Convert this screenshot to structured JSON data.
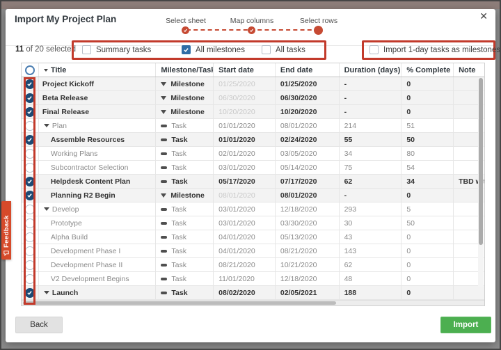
{
  "dialog": {
    "title": "Import My Project Plan",
    "close_glyph": "✕",
    "stepper": {
      "steps": [
        {
          "label": "Select sheet",
          "state": "done"
        },
        {
          "label": "Map columns",
          "state": "done"
        },
        {
          "label": "Select rows",
          "state": "current"
        }
      ]
    },
    "selection_summary": {
      "count": "11",
      "text": " of 20 selected"
    },
    "filter_checkboxes": [
      {
        "label": "Summary tasks",
        "checked": false
      },
      {
        "label": "All milestones",
        "checked": true
      },
      {
        "label": "All tasks",
        "checked": false
      }
    ],
    "import_option": {
      "label": "Import 1-day tasks as milestones",
      "checked": false
    },
    "table": {
      "columns": [
        "Title",
        "Milestone/Task",
        "Start date",
        "End date",
        "Duration (days)",
        "% Complete",
        "Note"
      ],
      "rows": [
        {
          "title": "Project Kickoff",
          "type": "Milestone",
          "start": "01/25/2020",
          "end": "01/25/2020",
          "duration": "-",
          "pct": "0",
          "note": "",
          "selected": true,
          "indent": 0,
          "expandable": false
        },
        {
          "title": "Beta Release",
          "type": "Milestone",
          "start": "06/30/2020",
          "end": "06/30/2020",
          "duration": "-",
          "pct": "0",
          "note": "",
          "selected": true,
          "indent": 0,
          "expandable": false
        },
        {
          "title": "Final Release",
          "type": "Milestone",
          "start": "10/20/2020",
          "end": "10/20/2020",
          "duration": "-",
          "pct": "0",
          "note": "",
          "selected": true,
          "indent": 0,
          "expandable": false
        },
        {
          "title": "Plan",
          "type": "Task",
          "start": "01/01/2020",
          "end": "08/01/2020",
          "duration": "214",
          "pct": "51",
          "note": "",
          "selected": false,
          "indent": 1,
          "expandable": true
        },
        {
          "title": "Assemble Resources",
          "type": "Task",
          "start": "01/01/2020",
          "end": "02/24/2020",
          "duration": "55",
          "pct": "50",
          "note": "",
          "selected": true,
          "indent": 2,
          "expandable": false
        },
        {
          "title": "Working Plans",
          "type": "Task",
          "start": "02/01/2020",
          "end": "03/05/2020",
          "duration": "34",
          "pct": "80",
          "note": "",
          "selected": false,
          "indent": 2,
          "expandable": false
        },
        {
          "title": "Subcontractor Selection",
          "type": "Task",
          "start": "03/01/2020",
          "end": "05/14/2020",
          "duration": "75",
          "pct": "54",
          "note": "",
          "selected": false,
          "indent": 2,
          "expandable": false
        },
        {
          "title": "Helpdesk Content Plan",
          "type": "Task",
          "start": "05/17/2020",
          "end": "07/17/2020",
          "duration": "62",
          "pct": "34",
          "note": "TBD with M",
          "selected": true,
          "indent": 2,
          "expandable": false
        },
        {
          "title": "Planning R2 Begin",
          "type": "Milestone",
          "start": "08/01/2020",
          "end": "08/01/2020",
          "duration": "-",
          "pct": "0",
          "note": "",
          "selected": true,
          "indent": 2,
          "expandable": false
        },
        {
          "title": "Develop",
          "type": "Task",
          "start": "03/01/2020",
          "end": "12/18/2020",
          "duration": "293",
          "pct": "5",
          "note": "",
          "selected": false,
          "indent": 1,
          "expandable": true
        },
        {
          "title": "Prototype",
          "type": "Task",
          "start": "03/01/2020",
          "end": "03/30/2020",
          "duration": "30",
          "pct": "50",
          "note": "",
          "selected": false,
          "indent": 2,
          "expandable": false
        },
        {
          "title": "Alpha Build",
          "type": "Task",
          "start": "04/01/2020",
          "end": "05/13/2020",
          "duration": "43",
          "pct": "0",
          "note": "",
          "selected": false,
          "indent": 2,
          "expandable": false
        },
        {
          "title": "Development Phase I",
          "type": "Task",
          "start": "04/01/2020",
          "end": "08/21/2020",
          "duration": "143",
          "pct": "0",
          "note": "",
          "selected": false,
          "indent": 2,
          "expandable": false
        },
        {
          "title": "Development Phase II",
          "type": "Task",
          "start": "08/21/2020",
          "end": "10/21/2020",
          "duration": "62",
          "pct": "0",
          "note": "",
          "selected": false,
          "indent": 2,
          "expandable": false
        },
        {
          "title": "V2 Development Begins",
          "type": "Task",
          "start": "11/01/2020",
          "end": "12/18/2020",
          "duration": "48",
          "pct": "0",
          "note": "",
          "selected": false,
          "indent": 2,
          "expandable": false
        },
        {
          "title": "Launch",
          "type": "Task",
          "start": "08/02/2020",
          "end": "02/05/2021",
          "duration": "188",
          "pct": "0",
          "note": "",
          "selected": true,
          "indent": 1,
          "expandable": true
        }
      ]
    },
    "footer": {
      "back_label": "Back",
      "import_label": "Import"
    }
  },
  "feedback_tab": {
    "label": "Feedback"
  },
  "colors": {
    "accent_red": "#c23a2b",
    "stepper_red": "#c64a33",
    "check_navy": "#1d4a74",
    "checkbox_blue": "#2f6da6",
    "import_green": "#4caf50",
    "feedback_orange": "#d64a2a",
    "backdrop_gray": "#8c8c8c",
    "backdrop_top": "#8e7e7a"
  }
}
